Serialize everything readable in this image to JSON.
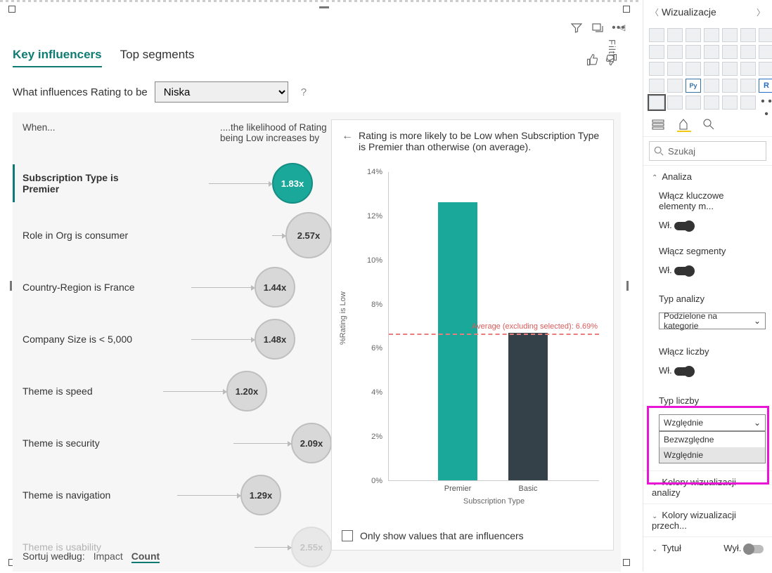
{
  "canvas": {
    "tabs": [
      "Key influencers",
      "Top segments"
    ],
    "active_tab": 0,
    "question_prefix": "What influences Rating to be",
    "question_value": "Niska",
    "help": "?",
    "col_when": "When...",
    "col_likely": "....the likelihood of Rating being Low increases by",
    "influencers": [
      {
        "label": "Subscription Type is Premier",
        "factor": "1.83x",
        "selected": true,
        "pos": 85
      },
      {
        "label": "Role in Org is consumer",
        "factor": "2.57x",
        "selected": false,
        "pos": 175,
        "big": true
      },
      {
        "label": "Country-Region is France",
        "factor": "1.44x",
        "selected": false,
        "pos": 60
      },
      {
        "label": "Company Size is < 5,000",
        "factor": "1.48x",
        "selected": false,
        "pos": 60
      },
      {
        "label": "Theme is speed",
        "factor": "1.20x",
        "selected": false,
        "pos": 20
      },
      {
        "label": "Theme is security",
        "factor": "2.09x",
        "selected": false,
        "pos": 120
      },
      {
        "label": "Theme is navigation",
        "factor": "1.29x",
        "selected": false,
        "pos": 40
      },
      {
        "label": "Theme is usability",
        "factor": "2.55x",
        "selected": false,
        "pos": 150,
        "faded": true
      }
    ],
    "sort_label": "Sortuj według:",
    "sort_options": [
      "Impact",
      "Count"
    ],
    "sort_active": 1,
    "card_desc": "Rating is more likely to be Low when Subscription Type is Premier than otherwise (on average).",
    "only_influencers": "Only show values that are influencers"
  },
  "chart_data": {
    "type": "bar",
    "title": "",
    "xlabel": "Subscription Type",
    "ylabel": "%Rating is Low",
    "categories": [
      "Premier",
      "Basic"
    ],
    "values": [
      12.6,
      6.69
    ],
    "ylim": [
      0,
      14
    ],
    "yticks": [
      0,
      2,
      4,
      6,
      8,
      10,
      12,
      14
    ],
    "avg_line": {
      "label": "Average (excluding selected): 6.69%",
      "value": 6.69
    }
  },
  "filters": {
    "label": "Filtry"
  },
  "viz_pane": {
    "title": "Wizualizacje",
    "search_placeholder": "Szukaj",
    "section_analiza": "Analiza",
    "enable_ki": "Włącz kluczowe elementy m...",
    "wl": "Wł.",
    "enable_segments": "Włącz segmenty",
    "typ_analizy": "Typ analizy",
    "typ_analizy_val": "Podzielone na kategorie",
    "enable_counts": "Włącz liczby",
    "typ_liczby": "Typ liczby",
    "typ_liczby_val": "Względnie",
    "typ_liczby_options": [
      "Bezwzględne",
      "Względnie"
    ],
    "kolory1": "Kolory wizualizacji analizy",
    "kolory2": "Kolory wizualizacji przech...",
    "tytul": "Tytuł",
    "wyl": "Wył."
  }
}
